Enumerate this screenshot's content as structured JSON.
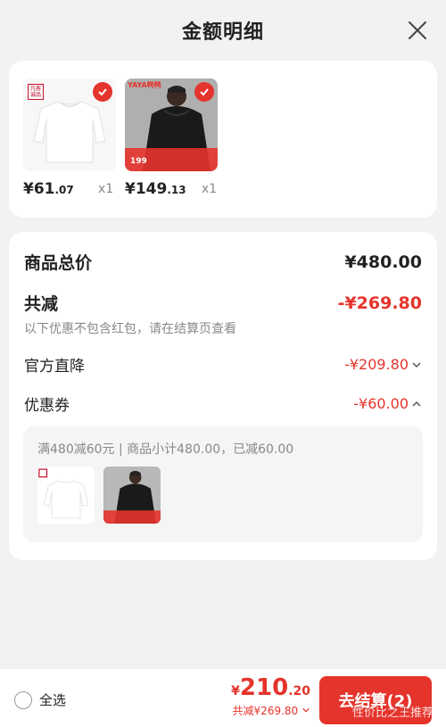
{
  "header": {
    "title": "金额明细"
  },
  "products": [
    {
      "price_int": "¥61",
      "price_dec": ".07",
      "qty": "x1",
      "brand": "凡客 诚品"
    },
    {
      "price_int": "¥149",
      "price_dec": ".13",
      "qty": "x1",
      "brand": "YAYA鸭鸭",
      "tag": "199"
    }
  ],
  "summary": {
    "total_label": "商品总价",
    "total_value": "¥480.00",
    "discount_label": "共减",
    "discount_value": "-¥269.80",
    "note": "以下优惠不包含红包，请在结算页查看",
    "official_label": "官方直降",
    "official_value": "-¥209.80",
    "coupon_label": "优惠券",
    "coupon_value": "-¥60.00",
    "coupon_desc": "满480减60元 | 商品小计480.00，已减60.00"
  },
  "bottom": {
    "select_all": "全选",
    "currency": "¥",
    "amount_int": "210",
    "amount_dec": ".20",
    "saved": "共减¥269.80",
    "checkout": "去结算(2)",
    "watermark": "性价比之王推荐"
  },
  "colors": {
    "accent": "#e5342c",
    "background": "#f2f2f2"
  }
}
